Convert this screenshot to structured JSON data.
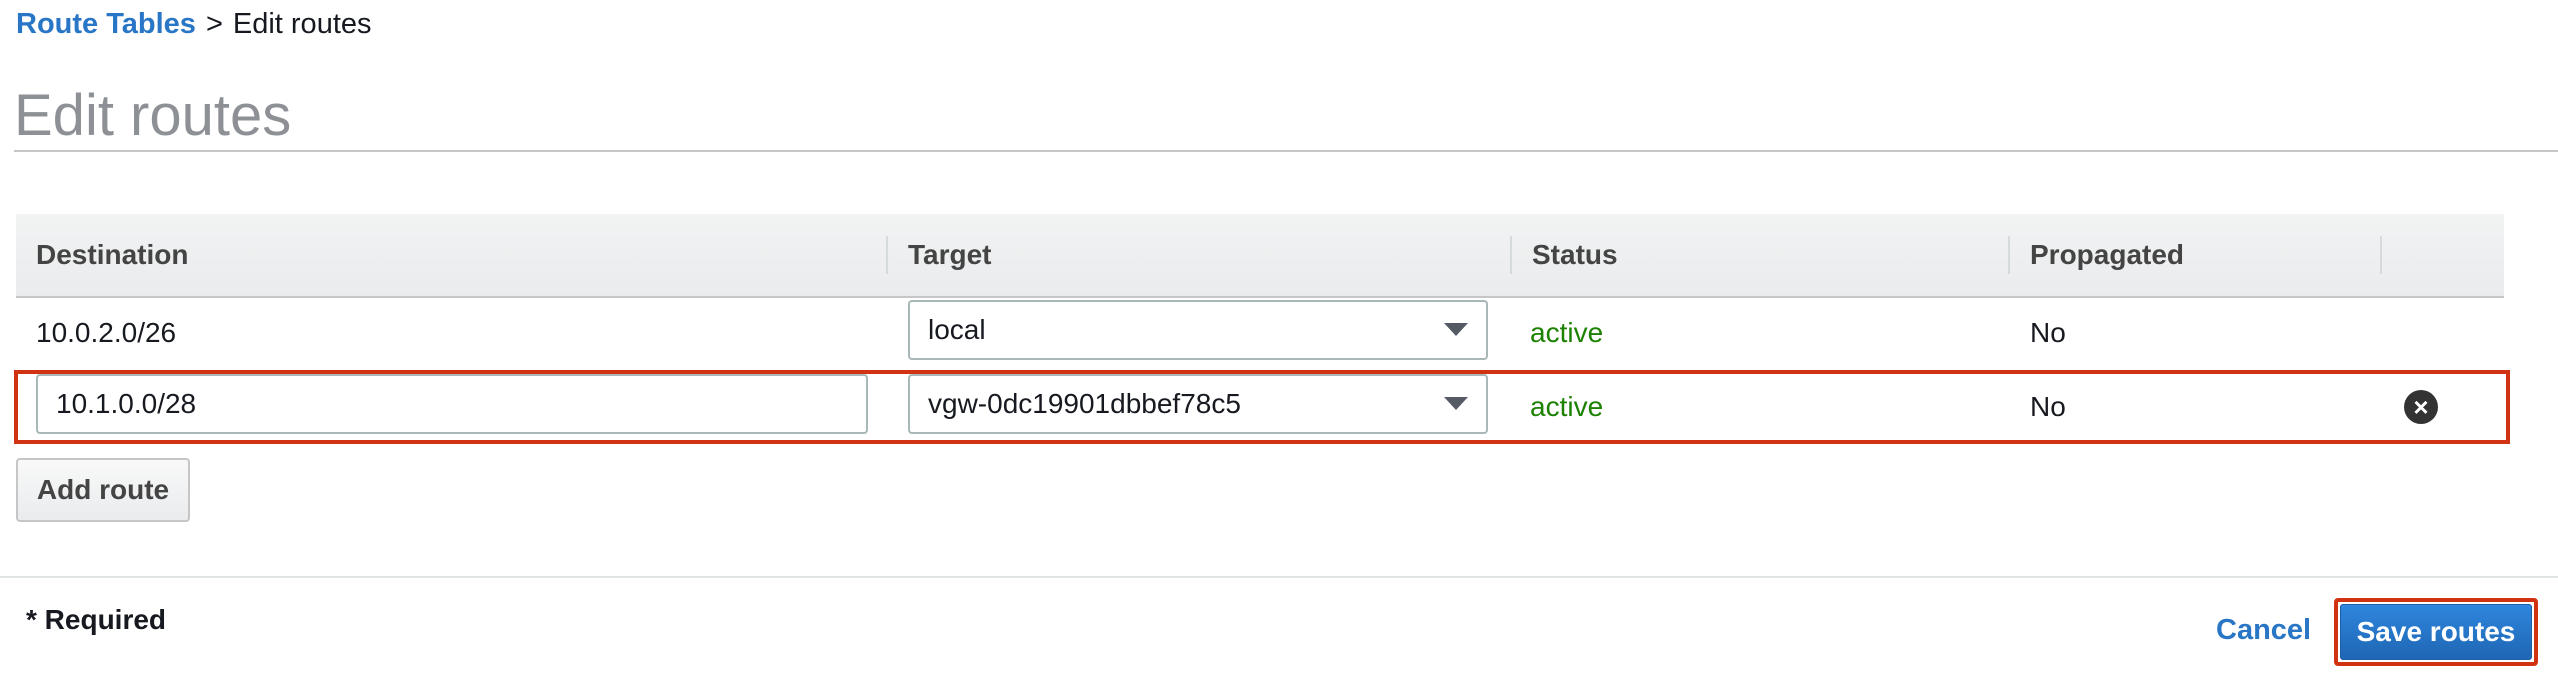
{
  "breadcrumb": {
    "link": "Route Tables",
    "separator": ">",
    "current": "Edit routes"
  },
  "page_title": "Edit routes",
  "table": {
    "columns": [
      "Destination",
      "Target",
      "Status",
      "Propagated"
    ],
    "rows": [
      {
        "destination": "10.0.2.0/26",
        "target": "local",
        "status": "active",
        "propagated": "No",
        "editable": false
      },
      {
        "destination": "10.1.0.0/28",
        "target": "vgw-0dc19901dbbef78c5",
        "status": "active",
        "propagated": "No",
        "editable": true
      }
    ]
  },
  "add_route_label": "Add route",
  "footer": {
    "required_label": "* Required",
    "cancel_label": "Cancel",
    "save_label": "Save routes"
  },
  "icons": {
    "remove_row": "remove-circle-icon",
    "dropdown": "caret-down-icon"
  },
  "colors": {
    "link": "#2a76c6",
    "status_active": "#1d8102",
    "primary_button": "#1f66b3",
    "highlight": "#d13212"
  }
}
